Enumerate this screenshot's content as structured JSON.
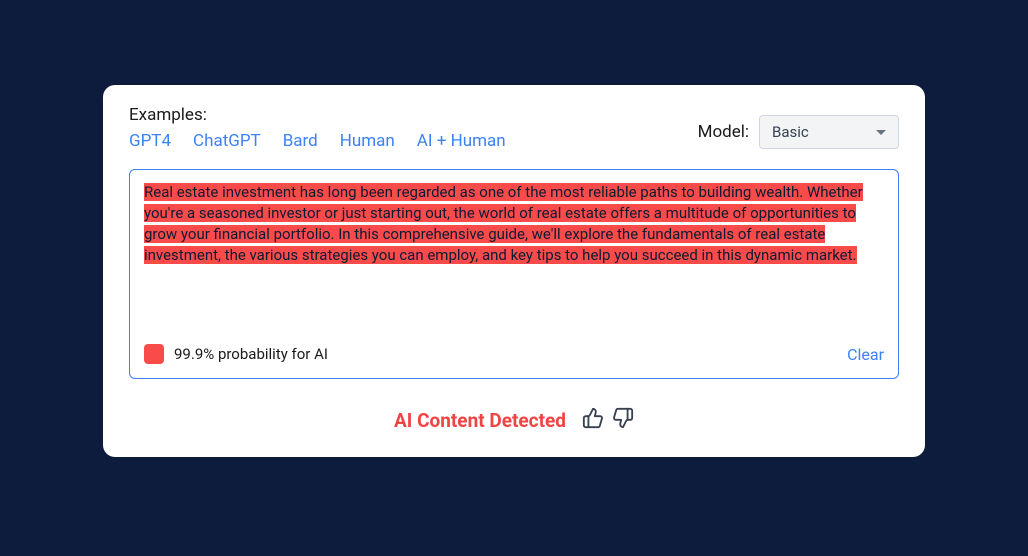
{
  "examples": {
    "label": "Examples:",
    "links": [
      "GPT4",
      "ChatGPT",
      "Bard",
      "Human",
      "AI + Human"
    ]
  },
  "model": {
    "label": "Model:",
    "selected": "Basic"
  },
  "textContent": "Real estate investment has long been regarded as one of the most reliable paths to building wealth. Whether you're a seasoned investor or just starting out, the world of real estate offers a multitude of opportunities to grow your financial portfolio. In this comprehensive guide, we'll explore the fundamentals of real estate investment, the various strategies you can employ, and key tips to help you succeed in this dynamic market.",
  "probability": {
    "text": "99.9% probability for AI"
  },
  "clear": "Clear",
  "result": "AI Content Detected",
  "colors": {
    "highlight": "#fa4b4b",
    "link": "#3b82f6",
    "danger": "#ef4444"
  }
}
